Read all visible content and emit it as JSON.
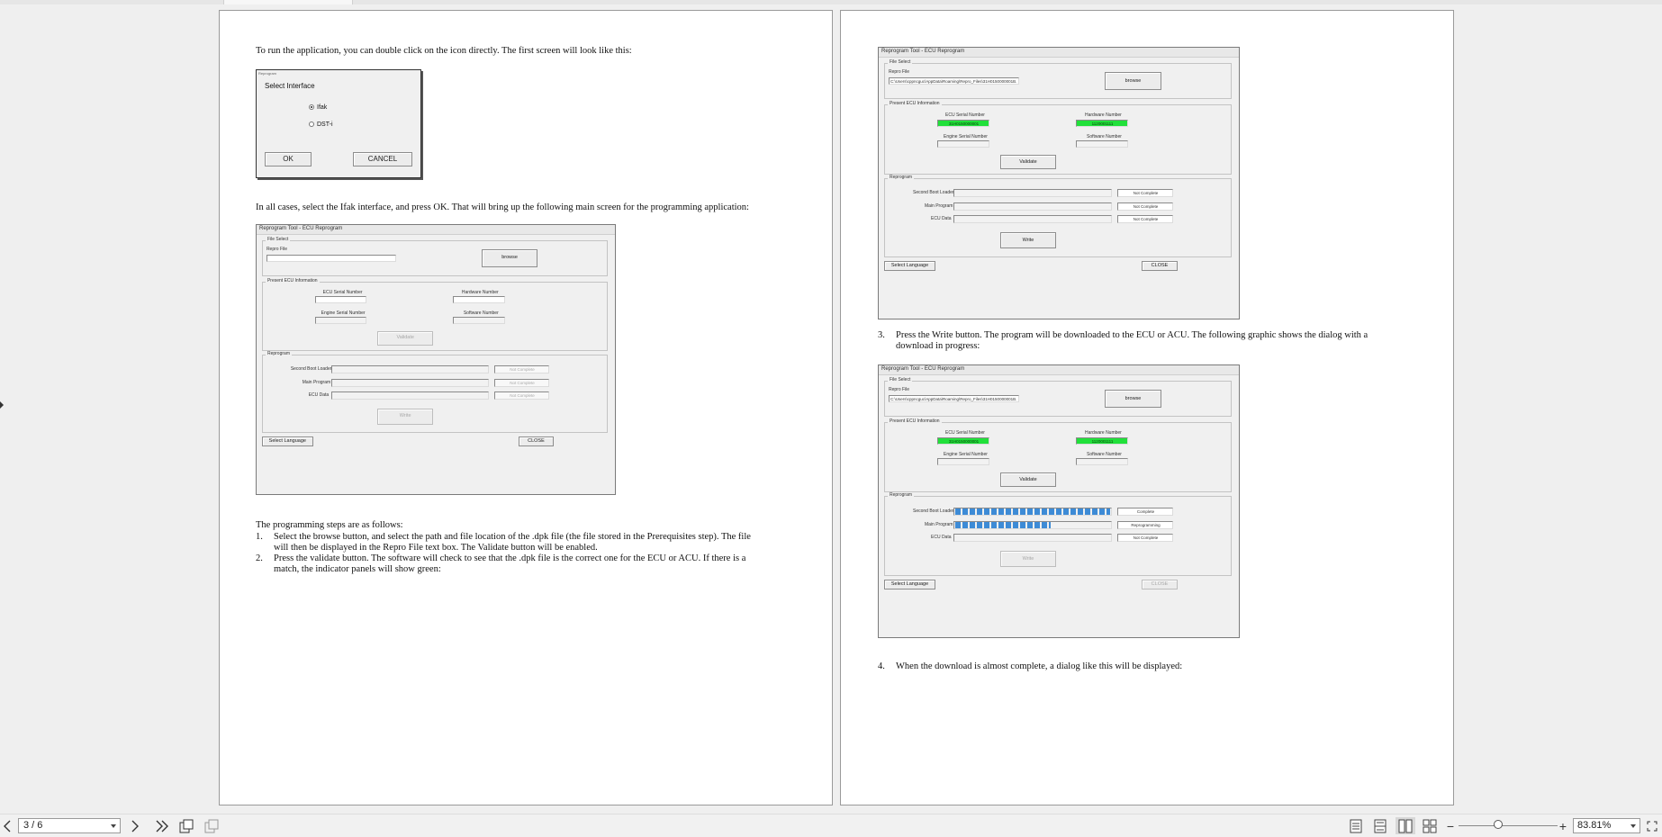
{
  "document": {
    "left_page": {
      "intro": "To run the application, you can double click on the icon directly.  The first screen will look like this:",
      "after_select": "In all cases, select the Ifak interface, and press OK.  That will bring up the following main screen for the programming application:",
      "steps_heading": "The programming steps are as follows:",
      "step1_num": "1.",
      "step1_line1": "Select the browse button, and select the path and file location of the .dpk file (the file stored in the Prerequisites step).  The file",
      "step1_line2": "will then be displayed in the Repro File text box.   The Validate button will be enabled.",
      "step2_num": "2.",
      "step2_line1": "Press the validate button.  The software will check to see that the .dpk file is the correct one for the ECU or ACU.  If there is a",
      "step2_line2": "match, the indicator panels will show green:"
    },
    "right_page": {
      "step3_num": "3.",
      "step3_line1": "Press the Write button.  The program will be downloaded to the ECU or ACU.  The following graphic shows the dialog with a",
      "step3_line2": "download in progress:",
      "step4_num": "4.",
      "step4_text": "When the download is almost complete, a dialog like this will be displayed:"
    }
  },
  "select_dialog": {
    "window_title": "Reprogram",
    "heading": "Select Interface",
    "options": [
      "Ifak",
      "DST-i"
    ],
    "selected": "Ifak",
    "ok": "OK",
    "cancel": "CANCEL"
  },
  "reprogram_dialog": {
    "title": "Reprogram Tool - ECU Reprogram",
    "file_select": "File Select",
    "repro_file_label": "Repro File",
    "browse": "browse",
    "present_ecu_info": "Present ECU Information",
    "ecu_serial_label": "ECU Serial Number",
    "hardware_label": "Hardware Number",
    "engine_serial_label": "Engine Serial Number",
    "software_label": "Software Number",
    "validate": "Validate",
    "reprogram": "Reprogram",
    "second_boot_loader": "Second Boot Loader",
    "main_program": "Main Program",
    "ecu_data": "ECU Data",
    "write": "Write",
    "select_language": "Select Language",
    "close": "CLOSE",
    "not_complete": "Not Complete",
    "complete": "Complete",
    "reprogramming": "Reprogramming"
  },
  "dialog_values": {
    "repro_path": "C:\\Users\\cppncguc\\AppData\\Roaming\\Repro_Files\\31H0150000001B.",
    "ecu_serial": "31H0150000001",
    "hardware_number": "1120001111",
    "progress_second_boot_loader": 1.0,
    "progress_main_program": 0.62
  },
  "statusbar": {
    "page_indicator": "3 / 6",
    "zoom": "83.81%",
    "zoom_minus": "−",
    "zoom_plus": "+",
    "icons": [
      "prev-page-icon",
      "next-page-icon",
      "last-page-icon",
      "rotate-icon",
      "copy-icon",
      "single-page-icon",
      "continuous-icon",
      "two-page-icon",
      "two-page-continuous-icon",
      "fullscreen-icon"
    ]
  }
}
